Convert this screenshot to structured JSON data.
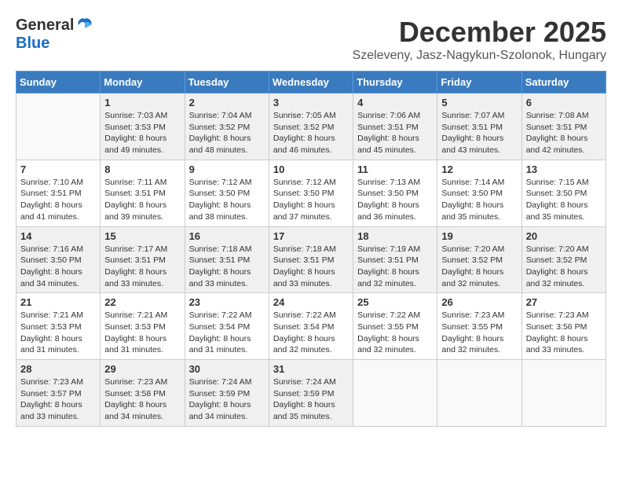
{
  "logo": {
    "general": "General",
    "blue": "Blue"
  },
  "title": {
    "month": "December 2025",
    "location": "Szeleveny, Jasz-Nagykun-Szolonok, Hungary"
  },
  "headers": [
    "Sunday",
    "Monday",
    "Tuesday",
    "Wednesday",
    "Thursday",
    "Friday",
    "Saturday"
  ],
  "weeks": [
    [
      {
        "day": "",
        "info": ""
      },
      {
        "day": "1",
        "info": "Sunrise: 7:03 AM\nSunset: 3:53 PM\nDaylight: 8 hours\nand 49 minutes."
      },
      {
        "day": "2",
        "info": "Sunrise: 7:04 AM\nSunset: 3:52 PM\nDaylight: 8 hours\nand 48 minutes."
      },
      {
        "day": "3",
        "info": "Sunrise: 7:05 AM\nSunset: 3:52 PM\nDaylight: 8 hours\nand 46 minutes."
      },
      {
        "day": "4",
        "info": "Sunrise: 7:06 AM\nSunset: 3:51 PM\nDaylight: 8 hours\nand 45 minutes."
      },
      {
        "day": "5",
        "info": "Sunrise: 7:07 AM\nSunset: 3:51 PM\nDaylight: 8 hours\nand 43 minutes."
      },
      {
        "day": "6",
        "info": "Sunrise: 7:08 AM\nSunset: 3:51 PM\nDaylight: 8 hours\nand 42 minutes."
      }
    ],
    [
      {
        "day": "7",
        "info": "Sunrise: 7:10 AM\nSunset: 3:51 PM\nDaylight: 8 hours\nand 41 minutes."
      },
      {
        "day": "8",
        "info": "Sunrise: 7:11 AM\nSunset: 3:51 PM\nDaylight: 8 hours\nand 39 minutes."
      },
      {
        "day": "9",
        "info": "Sunrise: 7:12 AM\nSunset: 3:50 PM\nDaylight: 8 hours\nand 38 minutes."
      },
      {
        "day": "10",
        "info": "Sunrise: 7:12 AM\nSunset: 3:50 PM\nDaylight: 8 hours\nand 37 minutes."
      },
      {
        "day": "11",
        "info": "Sunrise: 7:13 AM\nSunset: 3:50 PM\nDaylight: 8 hours\nand 36 minutes."
      },
      {
        "day": "12",
        "info": "Sunrise: 7:14 AM\nSunset: 3:50 PM\nDaylight: 8 hours\nand 35 minutes."
      },
      {
        "day": "13",
        "info": "Sunrise: 7:15 AM\nSunset: 3:50 PM\nDaylight: 8 hours\nand 35 minutes."
      }
    ],
    [
      {
        "day": "14",
        "info": "Sunrise: 7:16 AM\nSunset: 3:50 PM\nDaylight: 8 hours\nand 34 minutes."
      },
      {
        "day": "15",
        "info": "Sunrise: 7:17 AM\nSunset: 3:51 PM\nDaylight: 8 hours\nand 33 minutes."
      },
      {
        "day": "16",
        "info": "Sunrise: 7:18 AM\nSunset: 3:51 PM\nDaylight: 8 hours\nand 33 minutes."
      },
      {
        "day": "17",
        "info": "Sunrise: 7:18 AM\nSunset: 3:51 PM\nDaylight: 8 hours\nand 33 minutes."
      },
      {
        "day": "18",
        "info": "Sunrise: 7:19 AM\nSunset: 3:51 PM\nDaylight: 8 hours\nand 32 minutes."
      },
      {
        "day": "19",
        "info": "Sunrise: 7:20 AM\nSunset: 3:52 PM\nDaylight: 8 hours\nand 32 minutes."
      },
      {
        "day": "20",
        "info": "Sunrise: 7:20 AM\nSunset: 3:52 PM\nDaylight: 8 hours\nand 32 minutes."
      }
    ],
    [
      {
        "day": "21",
        "info": "Sunrise: 7:21 AM\nSunset: 3:53 PM\nDaylight: 8 hours\nand 31 minutes."
      },
      {
        "day": "22",
        "info": "Sunrise: 7:21 AM\nSunset: 3:53 PM\nDaylight: 8 hours\nand 31 minutes."
      },
      {
        "day": "23",
        "info": "Sunrise: 7:22 AM\nSunset: 3:54 PM\nDaylight: 8 hours\nand 31 minutes."
      },
      {
        "day": "24",
        "info": "Sunrise: 7:22 AM\nSunset: 3:54 PM\nDaylight: 8 hours\nand 32 minutes."
      },
      {
        "day": "25",
        "info": "Sunrise: 7:22 AM\nSunset: 3:55 PM\nDaylight: 8 hours\nand 32 minutes."
      },
      {
        "day": "26",
        "info": "Sunrise: 7:23 AM\nSunset: 3:55 PM\nDaylight: 8 hours\nand 32 minutes."
      },
      {
        "day": "27",
        "info": "Sunrise: 7:23 AM\nSunset: 3:56 PM\nDaylight: 8 hours\nand 33 minutes."
      }
    ],
    [
      {
        "day": "28",
        "info": "Sunrise: 7:23 AM\nSunset: 3:57 PM\nDaylight: 8 hours\nand 33 minutes."
      },
      {
        "day": "29",
        "info": "Sunrise: 7:23 AM\nSunset: 3:58 PM\nDaylight: 8 hours\nand 34 minutes."
      },
      {
        "day": "30",
        "info": "Sunrise: 7:24 AM\nSunset: 3:59 PM\nDaylight: 8 hours\nand 34 minutes."
      },
      {
        "day": "31",
        "info": "Sunrise: 7:24 AM\nSunset: 3:59 PM\nDaylight: 8 hours\nand 35 minutes."
      },
      {
        "day": "",
        "info": ""
      },
      {
        "day": "",
        "info": ""
      },
      {
        "day": "",
        "info": ""
      }
    ]
  ]
}
